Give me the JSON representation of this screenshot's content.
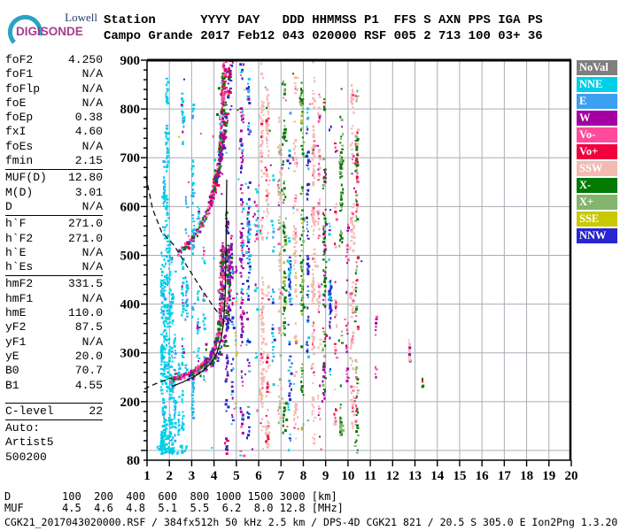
{
  "logo": {
    "top": "Lowell",
    "bottom": "DIGISONDE"
  },
  "header": {
    "line1": "Station      YYYY DAY   DDD HHMMSS P1  FFS S AXN PPS IGA PS",
    "line2": "Campo Grande 2017 Feb12 043 020000 RSF 005 2 713 100 03+ 36"
  },
  "params": {
    "groups": [
      [
        {
          "label": "foF2",
          "value": "4.250"
        },
        {
          "label": "foF1",
          "value": "N/A"
        },
        {
          "label": "foFlp",
          "value": "N/A"
        },
        {
          "label": "foE",
          "value": "N/A"
        },
        {
          "label": "foEp",
          "value": "0.38"
        },
        {
          "label": "fxI",
          "value": "4.60"
        },
        {
          "label": "foEs",
          "value": "N/A"
        },
        {
          "label": "fmin",
          "value": "2.15"
        }
      ],
      [
        {
          "label": "MUF(D)",
          "value": "12.80"
        },
        {
          "label": "M(D)",
          "value": "3.01"
        },
        {
          "label": "D",
          "value": "N/A"
        }
      ],
      [
        {
          "label": "h`F",
          "value": "271.0"
        },
        {
          "label": "h`F2",
          "value": "271.0"
        },
        {
          "label": "h`E",
          "value": "N/A"
        },
        {
          "label": "h`Es",
          "value": "N/A"
        }
      ],
      [
        {
          "label": "hmF2",
          "value": "331.5"
        },
        {
          "label": "hmF1",
          "value": "N/A"
        },
        {
          "label": "hmE",
          "value": "110.0"
        },
        {
          "label": "yF2",
          "value": "87.5"
        },
        {
          "label": "yF1",
          "value": "N/A"
        },
        {
          "label": "yE",
          "value": "20.0"
        },
        {
          "label": "B0",
          "value": "70.7"
        },
        {
          "label": "B1",
          "value": "4.55"
        }
      ]
    ],
    "c_level": {
      "label": "C-level",
      "value": "22"
    },
    "auto_lines": [
      "Auto:",
      "Artist5",
      "500200"
    ]
  },
  "legend": {
    "items": [
      {
        "label": "NoVal",
        "color": "#7f7f7f"
      },
      {
        "label": "NNE",
        "color": "#00cfe8"
      },
      {
        "label": "E",
        "color": "#3d9ff0"
      },
      {
        "label": "W",
        "color": "#a300a3"
      },
      {
        "label": "Vo-",
        "color": "#ff4b9b"
      },
      {
        "label": "Vo+",
        "color": "#f0003c"
      },
      {
        "label": "SSW",
        "color": "#f4bab2"
      },
      {
        "label": "X-",
        "color": "#027a02"
      },
      {
        "label": "X+",
        "color": "#84b56e"
      },
      {
        "label": "SSE",
        "color": "#c9c900"
      },
      {
        "label": "NNW",
        "color": "#2726cf"
      }
    ]
  },
  "footer": {
    "d_row": "D        100  200  400  600  800 1000 1500 3000 [km]",
    "muf_row": "MUF      4.5  4.6  4.8  5.1  5.5  6.2  8.0 12.8 [MHz]",
    "info": "CGK21_2017043020000.RSF / 384fx512h 50 kHz 2.5 km / DPS-4D CGK21 821 / 20.5 S 305.0 E Ion2Png 1.3.20"
  },
  "chart_data": {
    "type": "scatter",
    "title": "Digisonde RSF ionogram, Campo Grande, 2017 Feb12 (043) 02:00:00",
    "xlabel": "[MHz]",
    "ylabel": "[km]",
    "xlim": [
      1,
      20
    ],
    "ylim": [
      80,
      900
    ],
    "grid": true,
    "x_ticks": [
      1,
      2,
      3,
      4,
      5,
      6,
      7,
      8,
      9,
      10,
      11,
      12,
      13,
      14,
      15,
      16,
      17,
      18,
      19,
      20
    ],
    "y_tick_labels": [
      900,
      800,
      700,
      600,
      500,
      400,
      300,
      200,
      80
    ],
    "y_minor_step_km": 20,
    "scaled_values": {
      "foF2": 4.25,
      "fxI": 4.6,
      "fmin": 2.15,
      "hmF2": 331.5,
      "h_F": 271.0,
      "MUF_3000": 12.8
    },
    "colors": {
      "NoVal": "#7f7f7f",
      "NNE": "#00cfe8",
      "E": "#3d9ff0",
      "W": "#a300a3",
      "Vo-": "#ff4b9b",
      "Vo+": "#f0003c",
      "SSW": "#f4bab2",
      "X-": "#027a02",
      "X+": "#84b56e",
      "SSE": "#c9c900",
      "NNW": "#2726cf"
    },
    "traces": [
      {
        "name": "F-echo 1st order O-mode",
        "n": 380,
        "anchors": [
          [
            2.08,
            248
          ],
          [
            2.5,
            253
          ],
          [
            2.95,
            261
          ],
          [
            3.35,
            273
          ],
          [
            3.7,
            289
          ],
          [
            3.95,
            308
          ],
          [
            4.12,
            332
          ],
          [
            4.24,
            365
          ],
          [
            4.3,
            410
          ],
          [
            4.34,
            465
          ],
          [
            4.36,
            520
          ]
        ],
        "colors": {
          "Vo-": 0.3,
          "W": 0.28,
          "X-": 0.25,
          "Vo+": 0.09,
          "NNW": 0.08
        }
      },
      {
        "name": "F-echo 1st order X-mode",
        "n": 130,
        "anchors": [
          [
            2.7,
            250
          ],
          [
            3.3,
            260
          ],
          [
            3.8,
            275
          ],
          [
            4.15,
            295
          ],
          [
            4.4,
            320
          ],
          [
            4.55,
            360
          ],
          [
            4.63,
            420
          ],
          [
            4.67,
            480
          ],
          [
            4.7,
            540
          ]
        ],
        "colors": {
          "NNW": 0.35,
          "W": 0.25,
          "Vo-": 0.2,
          "X-": 0.2
        }
      },
      {
        "name": "F-echo 2nd order O-mode",
        "n": 330,
        "anchors": [
          [
            2.05,
            498
          ],
          [
            2.45,
            510
          ],
          [
            2.9,
            530
          ],
          [
            3.3,
            556
          ],
          [
            3.65,
            588
          ],
          [
            3.9,
            625
          ],
          [
            4.1,
            670
          ],
          [
            4.25,
            725
          ],
          [
            4.33,
            790
          ],
          [
            4.37,
            850
          ],
          [
            4.39,
            900
          ]
        ],
        "colors": {
          "Vo-": 0.32,
          "W": 0.28,
          "X-": 0.22,
          "Vo+": 0.1,
          "NNE": 0.08
        }
      },
      {
        "name": "F-echo 2nd order X-mode",
        "n": 110,
        "anchors": [
          [
            3.95,
            630
          ],
          [
            4.15,
            672
          ],
          [
            4.35,
            725
          ],
          [
            4.5,
            785
          ],
          [
            4.62,
            845
          ],
          [
            4.7,
            900
          ]
        ],
        "colors": {
          "NNW": 0.3,
          "W": 0.3,
          "X-": 0.2,
          "Vo+": 0.2
        }
      }
    ],
    "columns": [
      [
        1.62,
        95,
        510,
        80,
        {
          "NNE": 1
        },
        0.03
      ],
      [
        1.72,
        100,
        700,
        120,
        {
          "NNE": 0.9,
          "E": 0.1
        },
        0.04
      ],
      [
        1.85,
        95,
        880,
        100,
        {
          "NNE": 0.95,
          "E": 0.05
        },
        0.04
      ],
      [
        1.97,
        100,
        560,
        70,
        {
          "NNE": 1
        },
        0.03
      ],
      [
        2.08,
        95,
        520,
        55,
        {
          "NNE": 0.8,
          "E": 0.2
        },
        0.03
      ],
      [
        2.2,
        105,
        480,
        35,
        {
          "NNE": 0.7,
          "E": 0.3
        },
        0.03
      ],
      [
        2.38,
        130,
        300,
        18,
        {
          "NNE": 1
        },
        0.03
      ],
      [
        2.55,
        120,
        900,
        60,
        {
          "NNE": 0.9,
          "W": 0.1
        },
        0.03
      ],
      [
        2.72,
        260,
        720,
        28,
        {
          "E": 0.6,
          "NNE": 0.4
        },
        0.03
      ],
      [
        3.0,
        140,
        860,
        55,
        {
          "NNE": 0.6,
          "E": 0.4
        },
        0.04
      ],
      [
        3.25,
        200,
        620,
        26,
        {
          "NNE": 0.8,
          "W": 0.2
        },
        0.03
      ],
      [
        3.5,
        240,
        560,
        22,
        {
          "NNE": 0.7,
          "Vo-": 0.3
        },
        0.03
      ],
      [
        1.9,
        96,
        114,
        40,
        {
          "NNE": 1
        },
        0.25
      ],
      [
        2.6,
        100,
        115,
        10,
        {
          "NNE": 1
        },
        0.12
      ],
      [
        4.55,
        95,
        650,
        70,
        {
          "NNW": 0.35,
          "W": 0.25,
          "X-": 0.2,
          "Vo+": 0.1,
          "Vo-": 0.1
        },
        0.05
      ],
      [
        4.78,
        140,
        520,
        28,
        {
          "NNW": 0.5,
          "W": 0.3,
          "NNE": 0.2
        },
        0.04
      ],
      [
        4.95,
        150,
        550,
        14,
        {
          "SSE": 0.4,
          "W": 0.3,
          "NNE": 0.3
        },
        0.03
      ],
      [
        5.2,
        90,
        900,
        110,
        {
          "W": 0.6,
          "NNW": 0.15,
          "Vo-": 0.15,
          "NNE": 0.1
        },
        0.05
      ],
      [
        5.5,
        95,
        900,
        85,
        {
          "NNW": 0.4,
          "NNE": 0.35,
          "E": 0.15,
          "W": 0.1
        },
        0.05
      ],
      [
        5.85,
        180,
        660,
        24,
        {
          "Vo-": 0.5,
          "NNE": 0.3,
          "W": 0.2
        },
        0.04
      ],
      [
        6.1,
        100,
        900,
        125,
        {
          "SSW": 0.85,
          "Vo-": 0.1,
          "Vo+": 0.05
        },
        0.05
      ],
      [
        6.35,
        110,
        900,
        105,
        {
          "SSW": 0.9,
          "Vo+": 0.1
        },
        0.05
      ],
      [
        6.6,
        200,
        720,
        26,
        {
          "NNE": 0.5,
          "E": 0.3,
          "NNW": 0.2
        },
        0.04
      ],
      [
        6.9,
        140,
        860,
        75,
        {
          "SSW": 0.7,
          "X+": 0.2,
          "Vo-": 0.1
        },
        0.05
      ],
      [
        7.1,
        100,
        880,
        95,
        {
          "X-": 0.65,
          "X+": 0.3,
          "SSE": 0.05
        },
        0.05
      ],
      [
        7.35,
        100,
        880,
        65,
        {
          "NNW": 0.5,
          "NNE": 0.3,
          "E": 0.2
        },
        0.05
      ],
      [
        7.6,
        120,
        880,
        80,
        {
          "SSW": 0.8,
          "SSE": 0.1,
          "Vo-": 0.1
        },
        0.05
      ],
      [
        7.9,
        110,
        880,
        100,
        {
          "X-": 0.5,
          "X+": 0.4,
          "SSE": 0.1
        },
        0.05
      ],
      [
        8.15,
        120,
        860,
        55,
        {
          "NNW": 0.55,
          "E": 0.25,
          "NNE": 0.2
        },
        0.04
      ],
      [
        8.4,
        100,
        900,
        120,
        {
          "SSW": 0.9,
          "Vo-": 0.1
        },
        0.05
      ],
      [
        8.65,
        150,
        850,
        60,
        {
          "SSW": 0.7,
          "Vo-": 0.2,
          "W": 0.1
        },
        0.04
      ],
      [
        8.9,
        100,
        860,
        85,
        {
          "X-": 0.5,
          "W": 0.3,
          "Vo+": 0.1,
          "X+": 0.1
        },
        0.05
      ],
      [
        9.15,
        150,
        820,
        45,
        {
          "NNW": 0.5,
          "NNE": 0.3,
          "E": 0.2
        },
        0.04
      ],
      [
        9.4,
        150,
        750,
        35,
        {
          "SSW": 0.5,
          "Vo+": 0.25,
          "Vo-": 0.25
        },
        0.04
      ],
      [
        9.65,
        130,
        860,
        80,
        {
          "X-": 0.55,
          "X+": 0.45
        },
        0.05
      ],
      [
        9.9,
        200,
        700,
        26,
        {
          "W": 0.5,
          "Vo-": 0.5
        },
        0.04
      ],
      [
        10.15,
        110,
        880,
        95,
        {
          "SSW": 0.85,
          "Vo-": 0.15
        },
        0.05
      ],
      [
        10.35,
        95,
        900,
        115,
        {
          "X-": 0.3,
          "X+": 0.25,
          "Vo-": 0.2,
          "Vo+": 0.15,
          "SSW": 0.1
        },
        0.05
      ],
      [
        11.2,
        250,
        430,
        10,
        {
          "W": 0.6,
          "Vo-": 0.4
        },
        0.03
      ],
      [
        12.7,
        285,
        330,
        9,
        {
          "SSW": 0.6,
          "W": 0.4
        },
        0.02
      ],
      [
        13.3,
        230,
        265,
        5,
        {
          "Vo+": 0.5,
          "X-": 0.5
        },
        0.02
      ]
    ],
    "noise": {
      "n": 55,
      "f": [
        2.2,
        10.6
      ],
      "km": [
        100,
        880
      ],
      "colors": {
        "W": 0.2,
        "Vo-": 0.2,
        "NNE": 0.15,
        "X-": 0.15,
        "SSW": 0.15,
        "NNW": 0.1,
        "SSE": 0.05
      }
    },
    "curves": [
      {
        "name": "transmission-curve",
        "dash": true,
        "points": [
          [
            0.95,
            662
          ],
          [
            1.25,
            595
          ],
          [
            1.65,
            548
          ],
          [
            2.2,
            521
          ],
          [
            2.8,
            477
          ],
          [
            3.45,
            430
          ],
          [
            4.0,
            393
          ],
          [
            4.18,
            382
          ]
        ]
      },
      {
        "name": "profile-extrapolation",
        "dash": true,
        "points": [
          [
            0.88,
            226
          ],
          [
            1.35,
            236
          ],
          [
            1.8,
            244
          ],
          [
            2.1,
            249
          ]
        ]
      },
      {
        "name": "autoscaled-profile",
        "dash": false,
        "points": [
          [
            2.1,
            231
          ],
          [
            2.6,
            240
          ],
          [
            3.1,
            251
          ],
          [
            3.5,
            263
          ],
          [
            3.85,
            279
          ],
          [
            4.12,
            299
          ],
          [
            4.3,
            325
          ],
          [
            4.43,
            362
          ],
          [
            4.5,
            420
          ],
          [
            4.54,
            510
          ],
          [
            4.56,
            610
          ],
          [
            4.57,
            655
          ]
        ]
      }
    ]
  }
}
